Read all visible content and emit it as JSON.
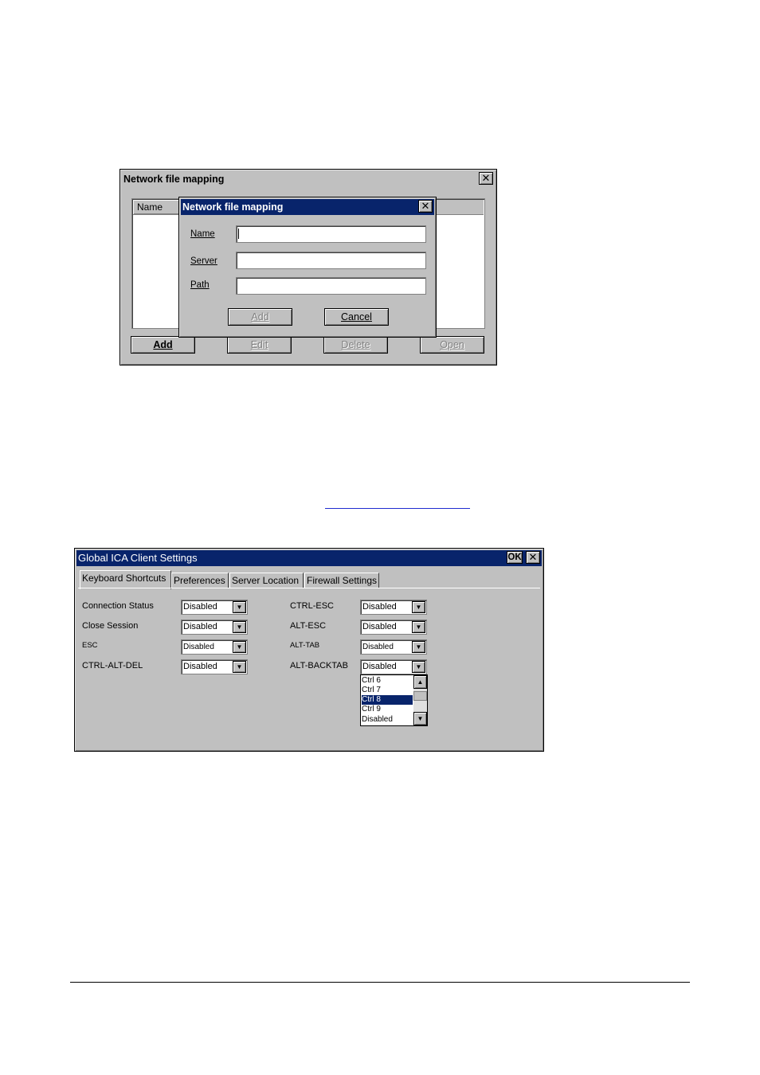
{
  "dialog1": {
    "title": "Network file mapping",
    "list_header": "Name",
    "buttons": {
      "add": "Add",
      "edit": "Edit",
      "delete": "Delete",
      "open": "Open"
    }
  },
  "dialog2": {
    "title": "Network file mapping",
    "fields": {
      "name_label": "Name",
      "server_label": "Server",
      "path_label": "Path",
      "name_value": "",
      "server_value": "",
      "path_value": ""
    },
    "buttons": {
      "add": "Add",
      "cancel": "Cancel"
    }
  },
  "global": {
    "title": "Global ICA Client Settings",
    "ok": "OK",
    "tabs": [
      "Keyboard Shortcuts",
      "Preferences",
      "Server Location",
      "Firewall Settings"
    ],
    "left_rows": [
      {
        "label": "Connection Status",
        "value": "Disabled"
      },
      {
        "label": "Close Session",
        "value": "Disabled"
      },
      {
        "label": "ESC",
        "value": "Disabled"
      },
      {
        "label": "CTRL-ALT-DEL",
        "value": "Disabled"
      }
    ],
    "right_rows": [
      {
        "label": "CTRL-ESC",
        "value": "Disabled"
      },
      {
        "label": "ALT-ESC",
        "value": "Disabled"
      },
      {
        "label": "ALT-TAB",
        "value": "Disabled"
      },
      {
        "label": "ALT-BACKTAB",
        "value": "Disabled"
      }
    ],
    "dropdown_options": [
      "Ctrl 6",
      "Ctrl 7",
      "Ctrl 8",
      "Ctrl 9",
      "Disabled"
    ],
    "dropdown_selected": "Ctrl 8"
  },
  "icons": {
    "close": "close-icon",
    "dropdown": "chevron-down-icon",
    "scroll_up": "arrow-up-icon",
    "scroll_down": "arrow-down-icon"
  },
  "colors": {
    "active_title": "#08246b",
    "window_face": "#c0c0c0",
    "selection": "#08246b"
  }
}
